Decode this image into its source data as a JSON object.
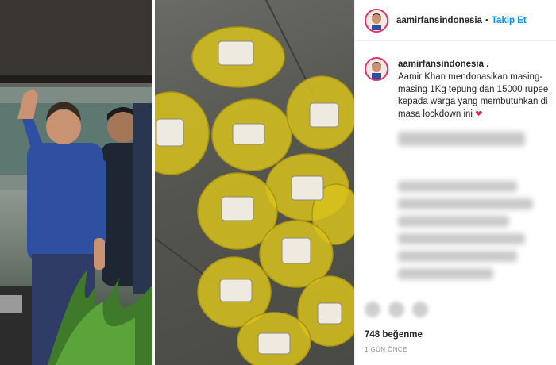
{
  "header": {
    "username": "aamirfansindonesia",
    "separator": "•",
    "follow_label": "Takip Et"
  },
  "caption": {
    "username": "aamirfansindonesia .",
    "text": "Aamir Khan mendonasikan masing-masing 1Kg tepung dan 15000 rupee kepada warga yang membutuhkan di masa lockdown ini ",
    "emoji": "❤"
  },
  "footer": {
    "likes": "748 beğenme",
    "time_ago": "1 GÜN ÖNCE"
  },
  "media": {
    "left_photo_icon": "person-waving",
    "right_photo_icon": "money-bags"
  },
  "colors": {
    "follow": "#0095f6",
    "avatar_ring": "#e1306c",
    "bag": "#d8c21c"
  }
}
